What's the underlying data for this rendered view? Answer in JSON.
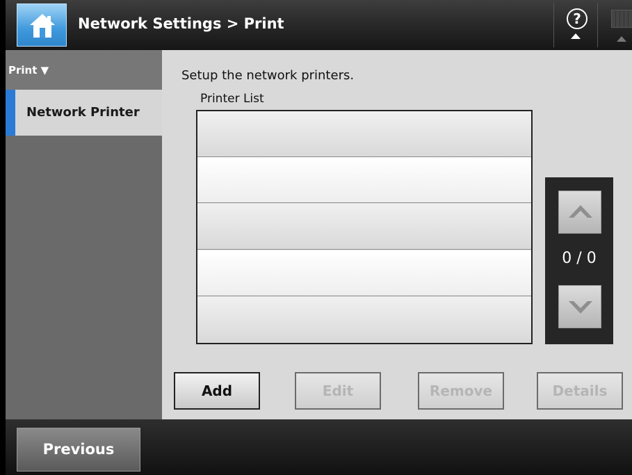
{
  "header": {
    "title": "Network Settings > Print",
    "home_icon": "home-icon",
    "help_icon": "help-icon",
    "keyboard_icon": "keyboard-icon"
  },
  "sidebar": {
    "group_label": "Print ▼",
    "items": [
      {
        "label": "Network Printer",
        "selected": true
      }
    ]
  },
  "main": {
    "instruction": "Setup the network printers.",
    "list_label": "Printer List",
    "rows": [
      "",
      "",
      "",
      "",
      ""
    ],
    "pager": "0 / 0",
    "scroll_up_icon": "chevron-up-icon",
    "scroll_down_icon": "chevron-down-icon",
    "buttons": {
      "add": "Add",
      "edit": "Edit",
      "remove": "Remove",
      "details": "Details"
    }
  },
  "footer": {
    "previous": "Previous"
  },
  "colors": {
    "accent": "#2a7ad6",
    "home_button": "#3f99dc",
    "sidebar_bg": "#6a6a6a",
    "content_bg": "#d9d9d9"
  }
}
